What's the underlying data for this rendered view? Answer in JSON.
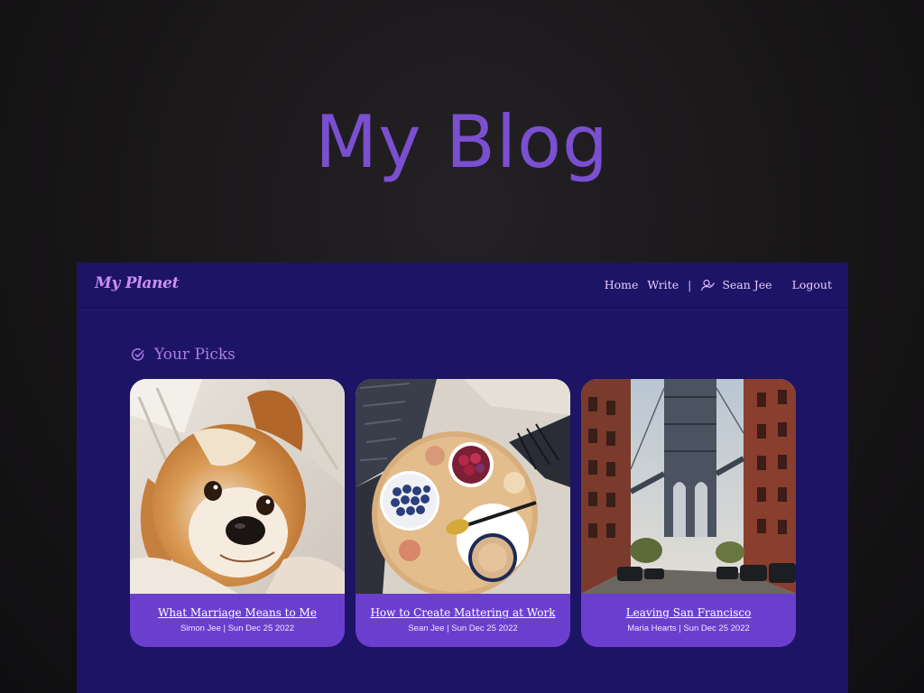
{
  "hero": {
    "title": "My Blog"
  },
  "navbar": {
    "brand": "My Planet",
    "home_label": "Home",
    "write_label": "Write",
    "separator": "|",
    "user_name": "Sean Jee",
    "logout_label": "Logout",
    "user_icon": "user-icon"
  },
  "section": {
    "title": "Your Picks",
    "icon": "check-circle-icon"
  },
  "cards": [
    {
      "title": "What Marriage Means to Me",
      "author": "Simon Jee",
      "date": "Sun Dec 25 2022",
      "meta": "Simon Jee | Sun Dec 25 2022",
      "image": "dog-photo"
    },
    {
      "title": "How to Create Mattering at Work",
      "author": "Sean Jee",
      "date": "Sun Dec 25 2022",
      "meta": "Sean Jee | Sun Dec 25 2022",
      "image": "breakfast-tray-photo"
    },
    {
      "title": "Leaving San Francisco",
      "author": "Maria Hearts",
      "date": "Sun Dec 25 2022",
      "meta": "Maria Hearts | Sun Dec 25 2022",
      "image": "bridge-street-photo"
    }
  ],
  "colors": {
    "page_background": "#1a1819",
    "hero_title": "#7a4fd0",
    "app_background": "#1e1466",
    "card_footer": "#6b3fce",
    "brand": "#c88ef5",
    "nav_text": "#e6ccff",
    "section_title": "#a97ee8"
  }
}
